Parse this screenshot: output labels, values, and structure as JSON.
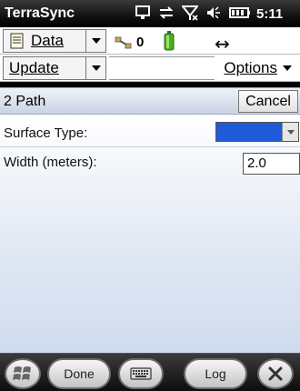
{
  "statusbar": {
    "app_title": "TerraSync",
    "clock": "5:11"
  },
  "toolbar1": {
    "data_label": "Data",
    "satellite_count": "0"
  },
  "toolbar2": {
    "update_label": "Update",
    "options_label": "Options"
  },
  "form": {
    "title": "2 Path",
    "cancel_label": "Cancel",
    "fields": [
      {
        "label": "Surface Type:",
        "value": ""
      },
      {
        "label": "Width (meters):",
        "value": "2.0"
      }
    ]
  },
  "bottom": {
    "done_label": "Done",
    "log_label": "Log"
  },
  "colors": {
    "selection": "#1e5bd8",
    "header_blue": "#c9d3e3"
  }
}
